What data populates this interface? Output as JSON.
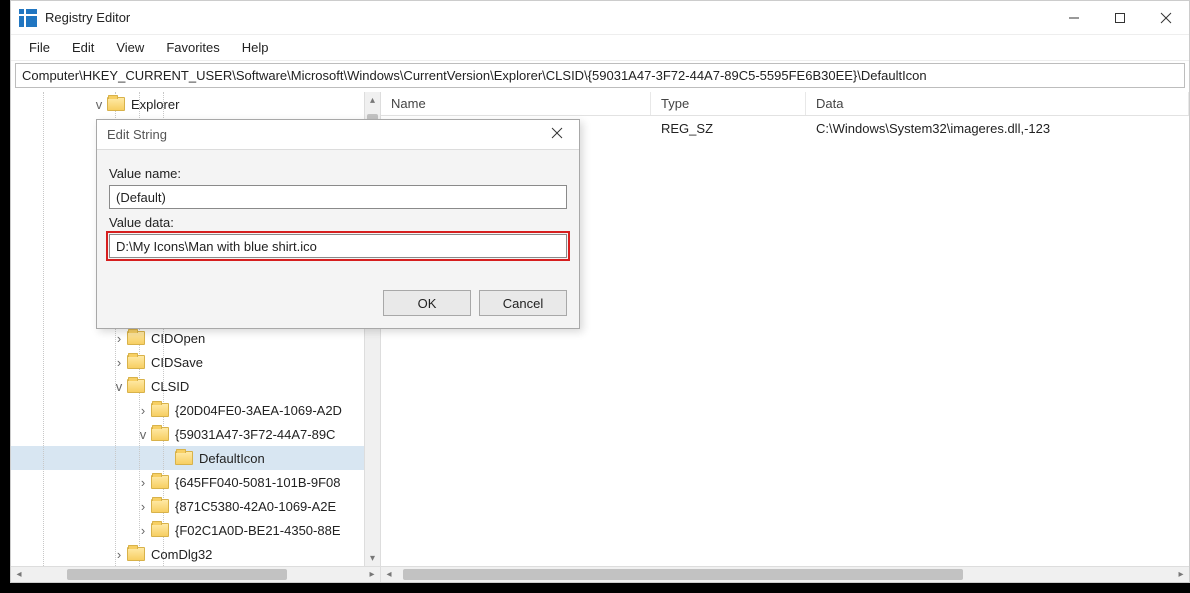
{
  "window": {
    "title": "Registry Editor",
    "minimize_tooltip": "Minimize",
    "maximize_tooltip": "Maximize",
    "close_tooltip": "Close"
  },
  "menu": {
    "file": "File",
    "edit": "Edit",
    "view": "View",
    "favorites": "Favorites",
    "help": "Help"
  },
  "address": "Computer\\HKEY_CURRENT_USER\\Software\\Microsoft\\Windows\\CurrentVersion\\Explorer\\CLSID\\{59031A47-3F72-44A7-89C5-5595FE6B30EE}\\DefaultIcon",
  "tree": {
    "root": "Explorer",
    "items": [
      {
        "indent": 4,
        "expander": ">",
        "label": "CIDOpen"
      },
      {
        "indent": 4,
        "expander": ">",
        "label": "CIDSave"
      },
      {
        "indent": 4,
        "expander": "v",
        "label": "CLSID"
      },
      {
        "indent": 5,
        "expander": ">",
        "label": "{20D04FE0-3AEA-1069-A2D"
      },
      {
        "indent": 5,
        "expander": "v",
        "label": "{59031A47-3F72-44A7-89C"
      },
      {
        "indent": 6,
        "expander": "",
        "label": "DefaultIcon",
        "selected": true
      },
      {
        "indent": 5,
        "expander": ">",
        "label": "{645FF040-5081-101B-9F08"
      },
      {
        "indent": 5,
        "expander": ">",
        "label": "{871C5380-42A0-1069-A2E"
      },
      {
        "indent": 5,
        "expander": ">",
        "label": "{F02C1A0D-BE21-4350-88E"
      },
      {
        "indent": 4,
        "expander": ">",
        "label": "ComDlg32"
      }
    ]
  },
  "list": {
    "columns": {
      "name": "Name",
      "type": "Type",
      "data": "Data"
    },
    "rows": [
      {
        "name": "",
        "type": "REG_SZ",
        "data": "C:\\Windows\\System32\\imageres.dll,-123"
      }
    ]
  },
  "dialog": {
    "title": "Edit String",
    "value_name_label": "Value name:",
    "value_name": "(Default)",
    "value_data_label": "Value data:",
    "value_data": "D:\\My Icons\\Man with blue shirt.ico",
    "ok": "OK",
    "cancel": "Cancel"
  }
}
